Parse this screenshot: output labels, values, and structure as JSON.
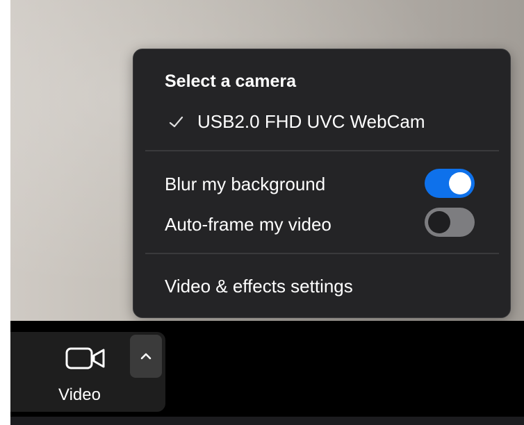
{
  "camera_menu": {
    "header": "Select a camera",
    "selected_camera": "USB2.0 FHD UVC WebCam",
    "blur_background_label": "Blur my background",
    "blur_background_on": true,
    "auto_frame_label": "Auto-frame my video",
    "auto_frame_on": false,
    "settings_label": "Video & effects settings"
  },
  "toolbar": {
    "video_label": "Video",
    "video_icon": "video-camera-icon",
    "chevron_icon": "chevron-up-icon"
  },
  "colors": {
    "toggle_on": "#0e71eb",
    "toggle_off": "#7d7d80",
    "menu_background": "#242426",
    "toolbar_background": "#000000"
  }
}
